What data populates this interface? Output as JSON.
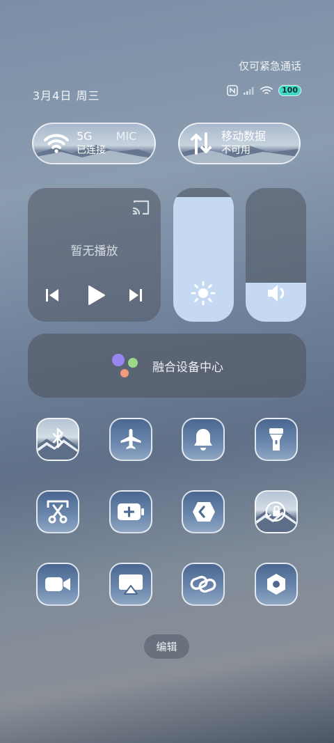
{
  "status": {
    "emergency_text": "仅可紧急通话",
    "date": "3月4日 周三",
    "battery": "100"
  },
  "wifi_pill": {
    "network_type": "5G",
    "label_extra": "MIC",
    "status": "已连接"
  },
  "data_pill": {
    "title": "移动数据",
    "status": "不可用"
  },
  "media": {
    "title": "暂无播放"
  },
  "sliders": {
    "brightness_level": 0.93,
    "volume_level": 0.29
  },
  "hub": {
    "label": "融合设备中心"
  },
  "toggles": [
    {
      "icon": "bluetooth-icon"
    },
    {
      "icon": "airplane-icon"
    },
    {
      "icon": "bell-icon"
    },
    {
      "icon": "flashlight-icon"
    },
    {
      "icon": "screenshot-scissors-icon"
    },
    {
      "icon": "battery-saver-icon"
    },
    {
      "icon": "location-share-icon"
    },
    {
      "icon": "rotation-lock-icon"
    },
    {
      "icon": "video-camera-icon"
    },
    {
      "icon": "screen-cast-icon"
    },
    {
      "icon": "link-icon"
    },
    {
      "icon": "settings-hex-icon"
    }
  ],
  "edit_label": "编辑",
  "colors": {
    "slider_fill": "#c5d9f2",
    "hub_dot_purple": "#9a86f0",
    "hub_dot_green": "#9bd88a",
    "hub_dot_orange": "#f09a7a",
    "battery": "#3fd9c4"
  }
}
